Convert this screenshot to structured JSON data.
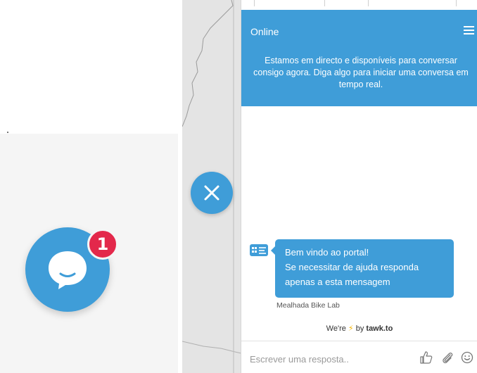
{
  "widget": {
    "unread_count": "1"
  },
  "chat": {
    "status_title": "Online",
    "header_message": "Estamos em directo e disponíveis para conversar consigo agora. Diga algo para iniciar uma conversa em tempo real.",
    "messages": [
      {
        "lines": [
          "Bem vindo ao portal!",
          "Se necessitar de ajuda responda",
          "apenas a esta mensagem"
        ],
        "sender": "Mealhada Bike Lab"
      }
    ],
    "branding": {
      "prefix": "We're",
      "bolt": "⚡",
      "middle": "by",
      "brand": "tawk.to"
    },
    "composer": {
      "placeholder": "Escrever uma resposta..",
      "value": ""
    },
    "icons": [
      "menu-icon",
      "thumbs-up-icon",
      "paperclip-icon",
      "smiley-icon",
      "close-icon",
      "chat-bubble-icon"
    ]
  },
  "colors": {
    "accent": "#3f9dd8",
    "badge": "#e3284b",
    "bolt": "#f6b500"
  }
}
